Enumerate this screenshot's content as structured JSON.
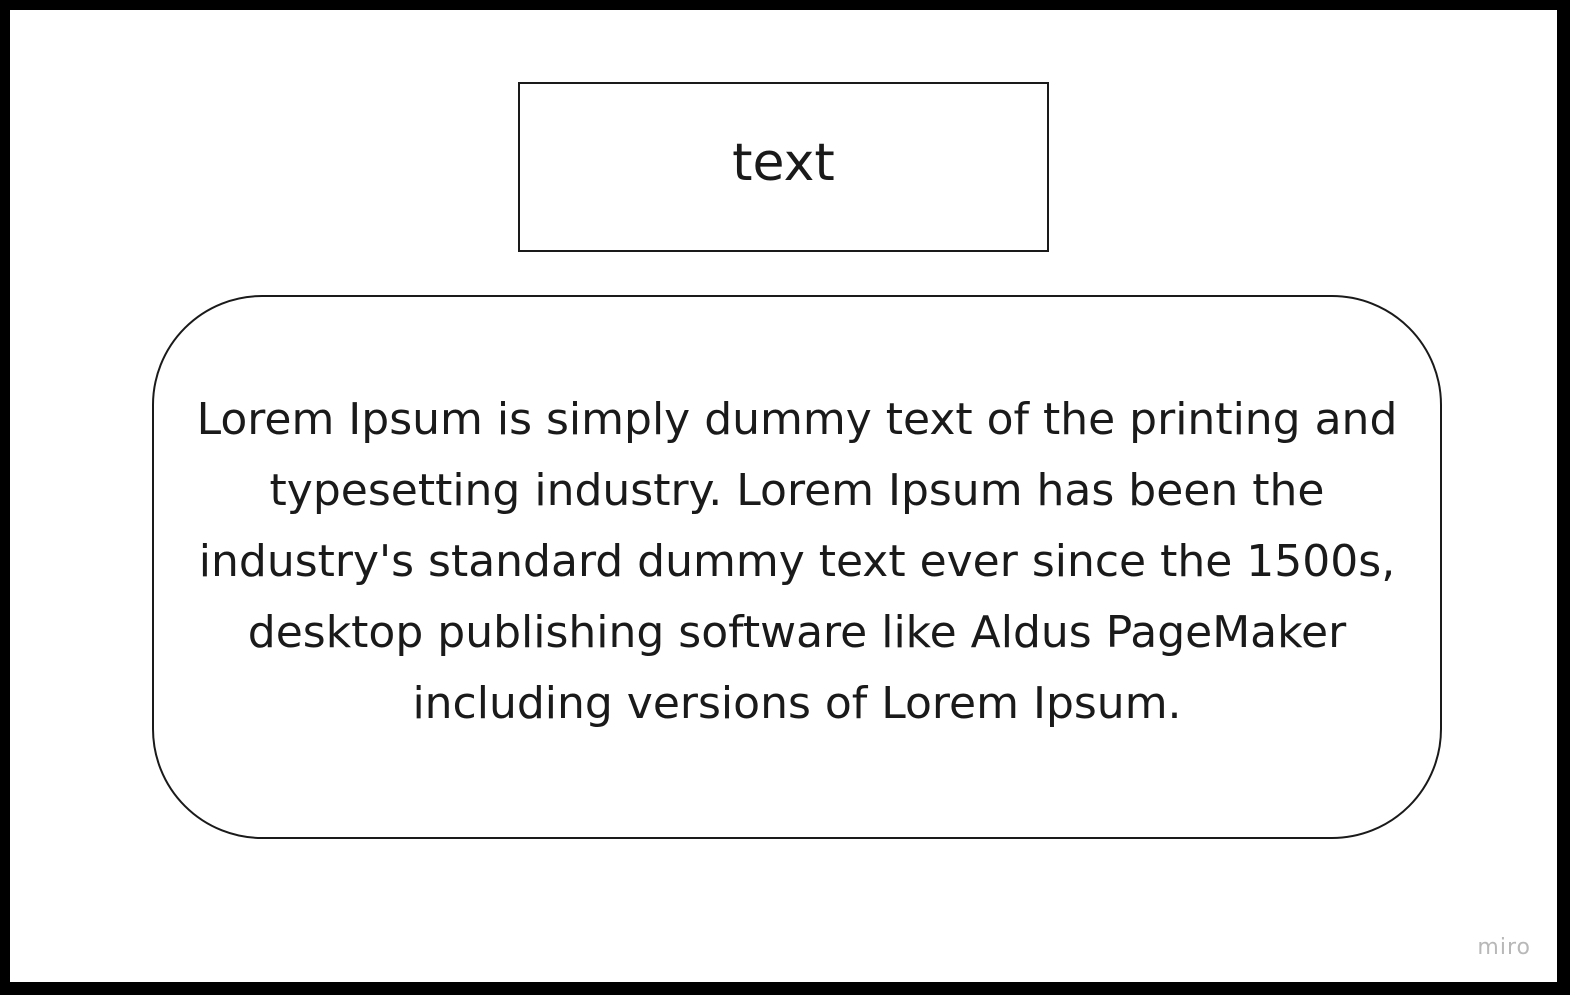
{
  "diagram": {
    "top_box": {
      "label": "text"
    },
    "rounded_box": {
      "text": "Lorem Ipsum is simply dummy text of the printing and typesetting industry. Lorem Ipsum has been the industry's standard dummy text ever since the 1500s, desktop publishing software like Aldus PageMaker including versions of Lorem Ipsum."
    }
  },
  "watermark": "miro",
  "colors": {
    "frame": "#000000",
    "canvas": "#ffffff",
    "stroke": "#1a1a1a",
    "text": "#1a1a1a",
    "watermark": "#b8b8b8"
  }
}
